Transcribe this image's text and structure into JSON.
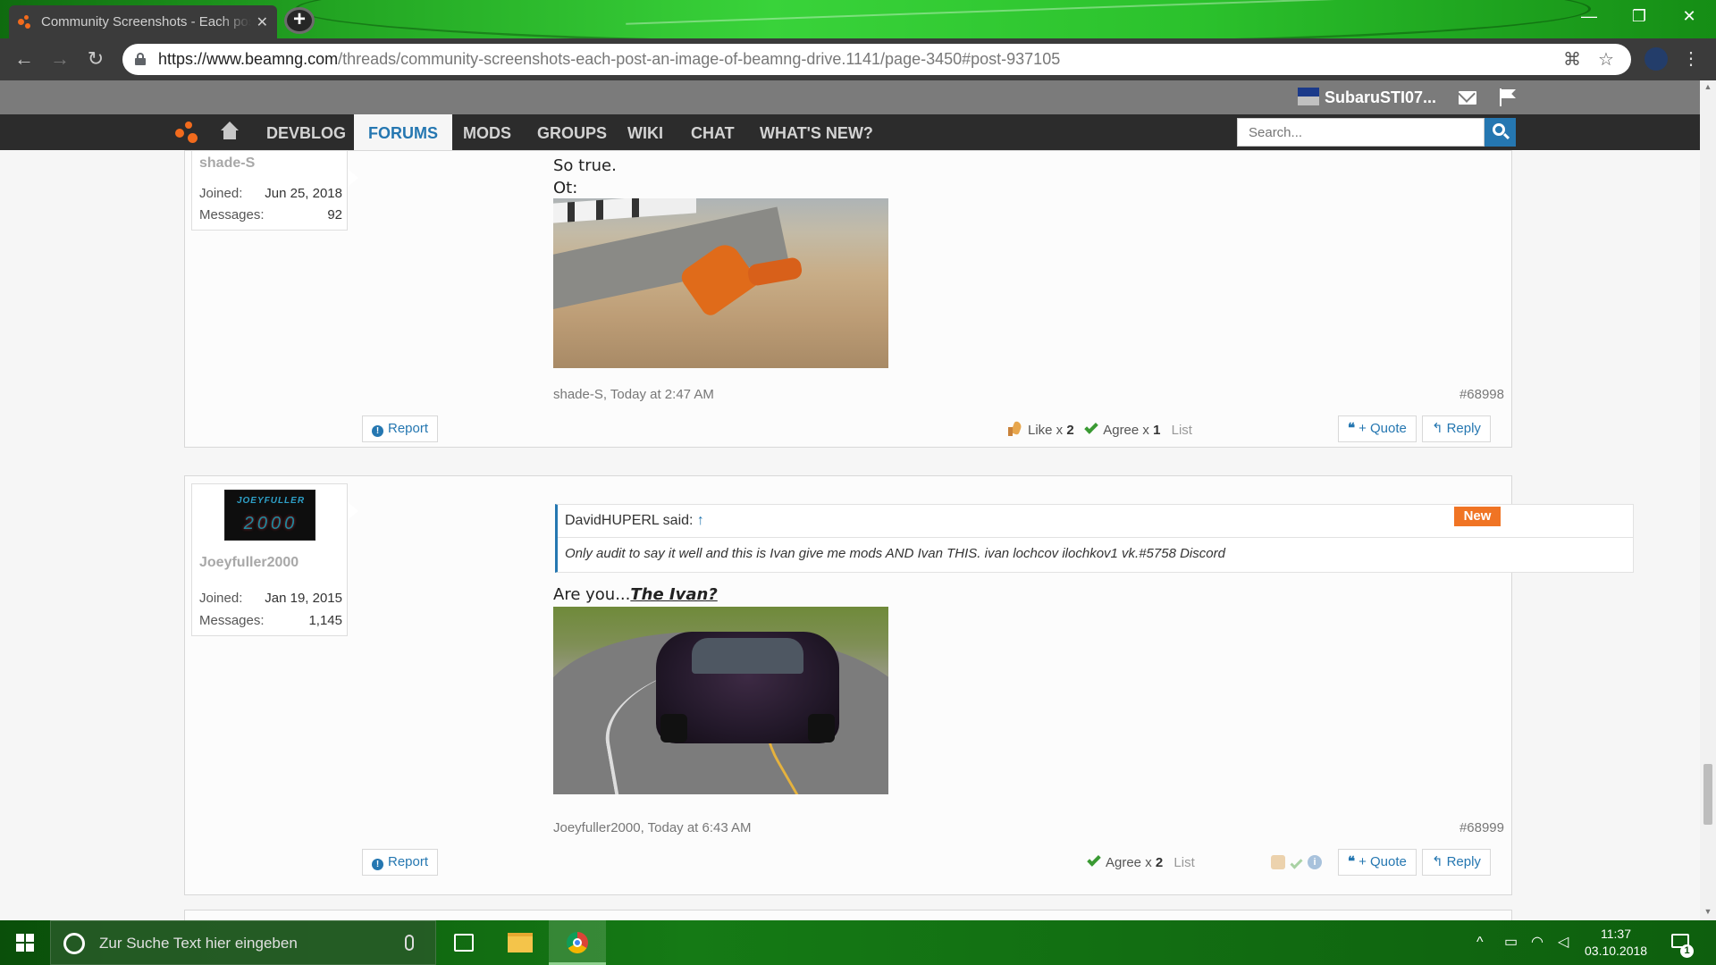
{
  "browser": {
    "tab_title": "Community Screenshots - Each post an image of BeamNG.drive",
    "tab_close": "✕",
    "new_tab": "+",
    "url_domain": "https://www.beamng.com",
    "url_path": "/threads/community-screenshots-each-post-an-image-of-beamng-drive.1141/page-3450#post-937105",
    "win_minimize": "—",
    "win_restore": "❐",
    "win_close": "✕"
  },
  "userbar": {
    "username": "SubaruSTI07..."
  },
  "nav": {
    "items": [
      "DEVBLOG",
      "FORUMS",
      "MODS",
      "GROUPS",
      "WIKI",
      "CHAT",
      "WHAT'S NEW?"
    ],
    "active": "FORUMS",
    "search_placeholder": "Search..."
  },
  "posts": [
    {
      "author": "shade-S",
      "joined_label": "Joined:",
      "joined": "Jun 25, 2018",
      "messages_label": "Messages:",
      "messages": "92",
      "text_line1": "So true.",
      "text_line2": "Ot:",
      "meta": "shade-S, Today at 2:47 AM",
      "number": "#68998",
      "report": "Report",
      "reactions": [
        {
          "label": "Like x",
          "count": "2"
        },
        {
          "label": "Agree x",
          "count": "1"
        }
      ],
      "list": "List",
      "quote": "+ Quote",
      "reply": "Reply"
    },
    {
      "author": "Joeyfuller2000",
      "avatar_line1": "JOEYFULLER",
      "avatar_line2": "2000",
      "joined_label": "Joined:",
      "joined": "Jan 19, 2015",
      "messages_label": "Messages:",
      "messages": "1,145",
      "quote_author": "DavidHUPERL said:",
      "quote_arrow": "↑",
      "quote_text": "Only audit to say it well and this is Ivan give me mods AND Ivan THIS. ivan lochcov ilochkov1 vk.#5758 Discord",
      "badge": "New",
      "text_prefix": "Are you...",
      "text_emph": "The Ivan?",
      "meta": "Joeyfuller2000, Today at 6:43 AM",
      "number": "#68999",
      "report": "Report",
      "reactions": [
        {
          "label": "Agree x",
          "count": "2"
        }
      ],
      "list": "List",
      "quote": "+ Quote",
      "reply": "Reply"
    }
  ],
  "taskbar": {
    "search_placeholder": "Zur Suche Text hier eingeben",
    "time": "11:37",
    "date": "03.10.2018",
    "notifications": "1"
  },
  "colors": {
    "accent": "#2577b1",
    "brand_orange": "#f26b1d",
    "new_badge": "#f07424",
    "navbar": "#2c2c2c"
  }
}
